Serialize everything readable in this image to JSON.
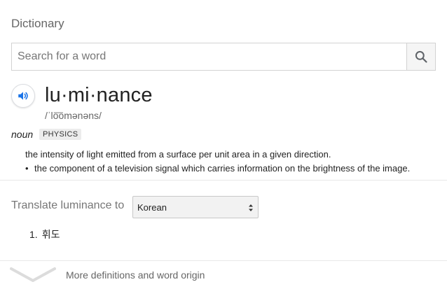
{
  "dictionary": {
    "title": "Dictionary",
    "search": {
      "placeholder": "Search for a word"
    }
  },
  "entry": {
    "headword": "lu·mi·nance",
    "phonetic": "/ˈlo͞omənəns/",
    "part_of_speech": "noun",
    "subject_tag": "PHYSICS",
    "definitions": [
      "the intensity of light emitted from a surface per unit area in a given direction.",
      "the component of a television signal which carries information on the brightness of the image."
    ]
  },
  "translate": {
    "label": "Translate luminance to",
    "selected_language": "Korean",
    "results": [
      {
        "number": "1.",
        "text": "휘도"
      }
    ]
  },
  "more": {
    "label": "More definitions and word origin"
  },
  "colors": {
    "accent": "#1a73e8",
    "muted_text": "#777777",
    "divider": "#e8e8e8"
  },
  "icons": [
    "search-icon",
    "speaker-icon",
    "chevron-down-icon",
    "select-arrows-icon"
  ]
}
